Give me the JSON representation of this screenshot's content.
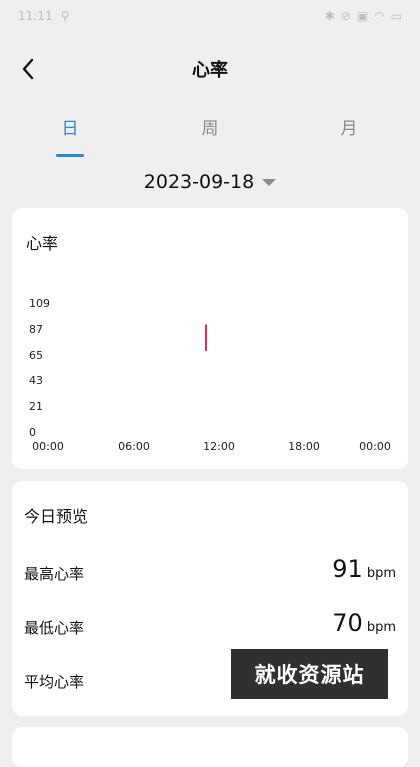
{
  "status": {
    "time": "11:11"
  },
  "nav": {
    "title": "心率"
  },
  "tabs": [
    {
      "label": "日",
      "active": true
    },
    {
      "label": "周",
      "active": false
    },
    {
      "label": "月",
      "active": false
    }
  ],
  "date": {
    "value": "2023-09-18"
  },
  "chart": {
    "title": "心率",
    "y_ticks": [
      "109",
      "87",
      "65",
      "43",
      "21",
      "0"
    ],
    "x_ticks": [
      "00:00",
      "06:00",
      "12:00",
      "18:00",
      "00:00"
    ]
  },
  "chart_data": {
    "type": "line",
    "title": "心率",
    "xlabel": "",
    "ylabel": "",
    "ylim": [
      0,
      109
    ],
    "x_ticks": [
      "00:00",
      "06:00",
      "12:00",
      "18:00",
      "00:00"
    ],
    "y_ticks": [
      109,
      87,
      65,
      43,
      21,
      0
    ],
    "series": [
      {
        "color": "#e0245e",
        "points": [
          [
            11.6,
            91
          ],
          [
            11.6,
            70
          ]
        ]
      }
    ]
  },
  "overview": {
    "title": "今日预览",
    "rows": [
      {
        "label": "最高心率",
        "value": "91",
        "unit": "bpm"
      },
      {
        "label": "最低心率",
        "value": "70",
        "unit": "bpm"
      },
      {
        "label": "平均心率",
        "value": "",
        "unit": ""
      }
    ]
  },
  "watermark": {
    "text": "就收资源站"
  }
}
